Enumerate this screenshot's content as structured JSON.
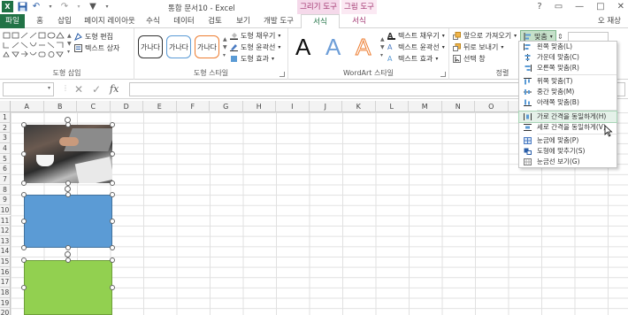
{
  "window": {
    "title": "통합 문서10 - Excel",
    "context_tab_draw": "그리기 도구",
    "context_tab_pic": "그림 도구",
    "user": "오 재상"
  },
  "tabs": {
    "file": "파일",
    "home": "홈",
    "insert": "삽입",
    "layout": "페이지 레이아웃",
    "formulas": "수식",
    "data": "데이터",
    "review": "검토",
    "view": "보기",
    "developer": "개발 도구",
    "format1": "서식",
    "format2": "서식"
  },
  "ribbon": {
    "shape_edit": "도형 편집",
    "textbox": "텍스트 상자",
    "group_insert_shapes": "도형 삽입",
    "style_sample": "가나다",
    "shape_fill": "도형 채우기",
    "shape_outline": "도형 윤곽선",
    "shape_effects": "도형 효과",
    "group_shape_styles": "도형 스타일",
    "wordart_letter": "A",
    "text_fill": "텍스트 채우기",
    "text_outline": "텍스트 윤곽선",
    "text_effects": "텍스트 효과",
    "group_wordart": "WordArt 스타일",
    "bring_forward": "앞으로 가져오기",
    "send_backward": "뒤로 보내기",
    "selection_pane": "선택 창",
    "group_arrange": "정렬",
    "align_button": "맞춤"
  },
  "formula_bar": {
    "fx": "fx",
    "cancel": "✕",
    "enter": "✓"
  },
  "columns": [
    "A",
    "B",
    "C",
    "D",
    "E",
    "F",
    "G",
    "H",
    "I",
    "J",
    "K",
    "L",
    "M",
    "N",
    "O",
    "P",
    "Q",
    "R"
  ],
  "rows": [
    "1",
    "2",
    "3",
    "4",
    "5",
    "6",
    "7",
    "8",
    "9",
    "10",
    "11",
    "12",
    "13",
    "14",
    "15",
    "16",
    "17",
    "18",
    "19",
    "20"
  ],
  "align_menu": [
    {
      "label": "왼쪽 맞춤(L)",
      "icon": "align-left-icon"
    },
    {
      "label": "가운데 맞춤(C)",
      "icon": "align-center-icon"
    },
    {
      "label": "오른쪽 맞춤(R)",
      "icon": "align-right-icon"
    },
    {
      "label": "위쪽 맞춤(T)",
      "icon": "align-top-icon"
    },
    {
      "label": "중간 맞춤(M)",
      "icon": "align-middle-icon"
    },
    {
      "label": "아래쪽 맞춤(B)",
      "icon": "align-bottom-icon"
    },
    {
      "label": "가로 간격을 동일하게(H)",
      "icon": "distribute-horizontal-icon"
    },
    {
      "label": "세로 간격을 동일하게(V)",
      "icon": "distribute-vertical-icon"
    },
    {
      "label": "눈금에 맞춤(P)",
      "icon": "snap-grid-icon"
    },
    {
      "label": "도형에 맞추기(S)",
      "icon": "snap-shape-icon"
    },
    {
      "label": "눈금선 보기(G)",
      "icon": "view-gridlines-icon"
    }
  ],
  "colors": {
    "excel_green": "#217346",
    "context_draw": "#f9e4f0",
    "blue_rect": "#5b9bd5",
    "green_rect": "#92d050"
  }
}
